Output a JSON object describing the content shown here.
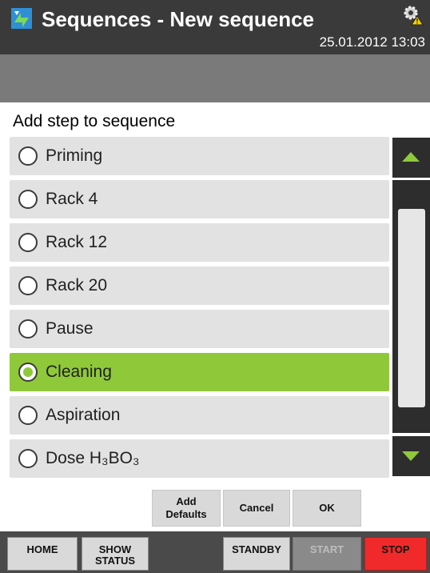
{
  "header": {
    "title": "Sequences - New sequence",
    "datetime": "25.01.2012 13:03"
  },
  "dialog": {
    "heading": "Add step to sequence",
    "selected_step": "Cleaning",
    "steps": [
      {
        "label": "Priming",
        "selected": false
      },
      {
        "label": "Rack 4",
        "selected": false
      },
      {
        "label": "Rack 12",
        "selected": false
      },
      {
        "label": "Rack 20",
        "selected": false
      },
      {
        "label": "Pause",
        "selected": false
      },
      {
        "label": "Cleaning",
        "selected": true
      },
      {
        "label": "Aspiration",
        "selected": false
      },
      {
        "label": "Dose H₃BO₃",
        "selected": false
      }
    ],
    "buttons": {
      "add_defaults_line1": "Add",
      "add_defaults_line2": "Defaults",
      "cancel": "Cancel",
      "ok": "OK"
    }
  },
  "bottom_nav": {
    "home": "HOME",
    "show_status_line1": "SHOW",
    "show_status_line2": "STATUS",
    "standby": "STANDBY",
    "start": "START",
    "stop": "STOP"
  },
  "colors": {
    "header_bg": "#3a3a3a",
    "accent_green": "#8fc93a",
    "item_bg": "#e2e2e2",
    "stop_red": "#f02a2a"
  },
  "icons": {
    "app": "sequence-arrows-icon",
    "status": "gear-warning-icon",
    "radio": "radio-button-icon",
    "scroll_up": "arrow-up-icon",
    "scroll_down": "arrow-down-icon"
  }
}
